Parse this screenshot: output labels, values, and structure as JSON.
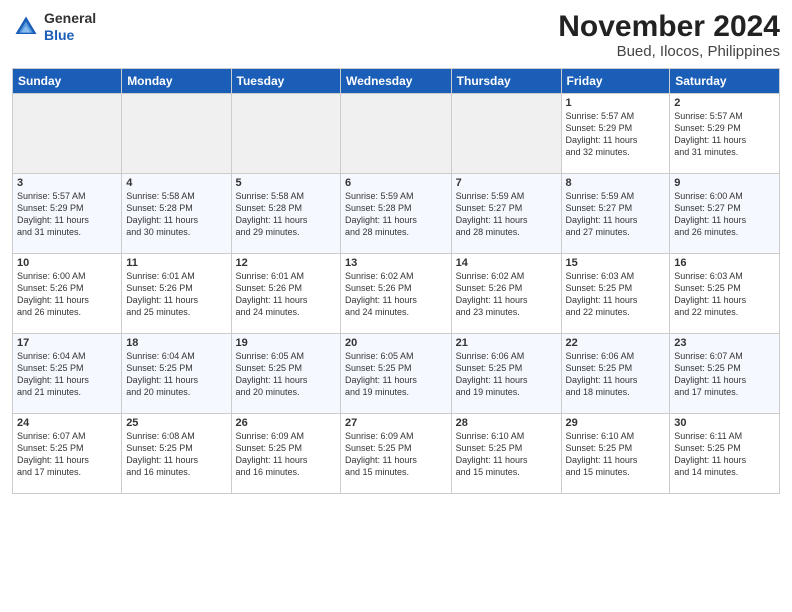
{
  "header": {
    "logo": {
      "general": "General",
      "blue": "Blue"
    },
    "title": "November 2024",
    "subtitle": "Bued, Ilocos, Philippines"
  },
  "calendar": {
    "days_of_week": [
      "Sunday",
      "Monday",
      "Tuesday",
      "Wednesday",
      "Thursday",
      "Friday",
      "Saturday"
    ],
    "weeks": [
      [
        {
          "day": "",
          "info": ""
        },
        {
          "day": "",
          "info": ""
        },
        {
          "day": "",
          "info": ""
        },
        {
          "day": "",
          "info": ""
        },
        {
          "day": "",
          "info": ""
        },
        {
          "day": "1",
          "info": "Sunrise: 5:57 AM\nSunset: 5:29 PM\nDaylight: 11 hours\nand 32 minutes."
        },
        {
          "day": "2",
          "info": "Sunrise: 5:57 AM\nSunset: 5:29 PM\nDaylight: 11 hours\nand 31 minutes."
        }
      ],
      [
        {
          "day": "3",
          "info": "Sunrise: 5:57 AM\nSunset: 5:29 PM\nDaylight: 11 hours\nand 31 minutes."
        },
        {
          "day": "4",
          "info": "Sunrise: 5:58 AM\nSunset: 5:28 PM\nDaylight: 11 hours\nand 30 minutes."
        },
        {
          "day": "5",
          "info": "Sunrise: 5:58 AM\nSunset: 5:28 PM\nDaylight: 11 hours\nand 29 minutes."
        },
        {
          "day": "6",
          "info": "Sunrise: 5:59 AM\nSunset: 5:28 PM\nDaylight: 11 hours\nand 28 minutes."
        },
        {
          "day": "7",
          "info": "Sunrise: 5:59 AM\nSunset: 5:27 PM\nDaylight: 11 hours\nand 28 minutes."
        },
        {
          "day": "8",
          "info": "Sunrise: 5:59 AM\nSunset: 5:27 PM\nDaylight: 11 hours\nand 27 minutes."
        },
        {
          "day": "9",
          "info": "Sunrise: 6:00 AM\nSunset: 5:27 PM\nDaylight: 11 hours\nand 26 minutes."
        }
      ],
      [
        {
          "day": "10",
          "info": "Sunrise: 6:00 AM\nSunset: 5:26 PM\nDaylight: 11 hours\nand 26 minutes."
        },
        {
          "day": "11",
          "info": "Sunrise: 6:01 AM\nSunset: 5:26 PM\nDaylight: 11 hours\nand 25 minutes."
        },
        {
          "day": "12",
          "info": "Sunrise: 6:01 AM\nSunset: 5:26 PM\nDaylight: 11 hours\nand 24 minutes."
        },
        {
          "day": "13",
          "info": "Sunrise: 6:02 AM\nSunset: 5:26 PM\nDaylight: 11 hours\nand 24 minutes."
        },
        {
          "day": "14",
          "info": "Sunrise: 6:02 AM\nSunset: 5:26 PM\nDaylight: 11 hours\nand 23 minutes."
        },
        {
          "day": "15",
          "info": "Sunrise: 6:03 AM\nSunset: 5:25 PM\nDaylight: 11 hours\nand 22 minutes."
        },
        {
          "day": "16",
          "info": "Sunrise: 6:03 AM\nSunset: 5:25 PM\nDaylight: 11 hours\nand 22 minutes."
        }
      ],
      [
        {
          "day": "17",
          "info": "Sunrise: 6:04 AM\nSunset: 5:25 PM\nDaylight: 11 hours\nand 21 minutes."
        },
        {
          "day": "18",
          "info": "Sunrise: 6:04 AM\nSunset: 5:25 PM\nDaylight: 11 hours\nand 20 minutes."
        },
        {
          "day": "19",
          "info": "Sunrise: 6:05 AM\nSunset: 5:25 PM\nDaylight: 11 hours\nand 20 minutes."
        },
        {
          "day": "20",
          "info": "Sunrise: 6:05 AM\nSunset: 5:25 PM\nDaylight: 11 hours\nand 19 minutes."
        },
        {
          "day": "21",
          "info": "Sunrise: 6:06 AM\nSunset: 5:25 PM\nDaylight: 11 hours\nand 19 minutes."
        },
        {
          "day": "22",
          "info": "Sunrise: 6:06 AM\nSunset: 5:25 PM\nDaylight: 11 hours\nand 18 minutes."
        },
        {
          "day": "23",
          "info": "Sunrise: 6:07 AM\nSunset: 5:25 PM\nDaylight: 11 hours\nand 17 minutes."
        }
      ],
      [
        {
          "day": "24",
          "info": "Sunrise: 6:07 AM\nSunset: 5:25 PM\nDaylight: 11 hours\nand 17 minutes."
        },
        {
          "day": "25",
          "info": "Sunrise: 6:08 AM\nSunset: 5:25 PM\nDaylight: 11 hours\nand 16 minutes."
        },
        {
          "day": "26",
          "info": "Sunrise: 6:09 AM\nSunset: 5:25 PM\nDaylight: 11 hours\nand 16 minutes."
        },
        {
          "day": "27",
          "info": "Sunrise: 6:09 AM\nSunset: 5:25 PM\nDaylight: 11 hours\nand 15 minutes."
        },
        {
          "day": "28",
          "info": "Sunrise: 6:10 AM\nSunset: 5:25 PM\nDaylight: 11 hours\nand 15 minutes."
        },
        {
          "day": "29",
          "info": "Sunrise: 6:10 AM\nSunset: 5:25 PM\nDaylight: 11 hours\nand 15 minutes."
        },
        {
          "day": "30",
          "info": "Sunrise: 6:11 AM\nSunset: 5:25 PM\nDaylight: 11 hours\nand 14 minutes."
        }
      ]
    ]
  }
}
